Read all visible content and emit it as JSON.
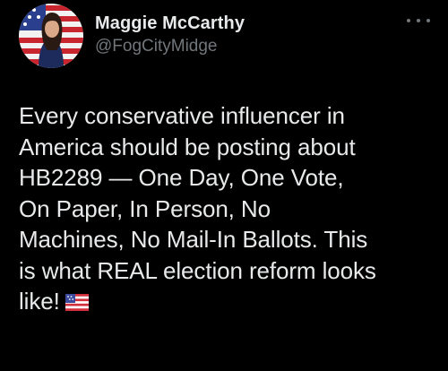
{
  "tweet": {
    "author": {
      "display_name": "Maggie McCarthy",
      "handle": "@FogCityMidge"
    },
    "text": "Every conservative influencer in\nAmerica should be posting about\nHB2289 — One Day, One Vote,\nOn Paper, In Person, No\nMachines, No Mail-In Ballots. This\nis what REAL election reform looks\nlike!",
    "emoji": "us-flag-emoji"
  },
  "icons": {
    "more": "more-options-icon",
    "avatar": "user-avatar",
    "flag": "us-flag-emoji"
  },
  "colors": {
    "background": "#000000",
    "primary_text": "#e7e9ea",
    "secondary_text": "#71767b"
  }
}
